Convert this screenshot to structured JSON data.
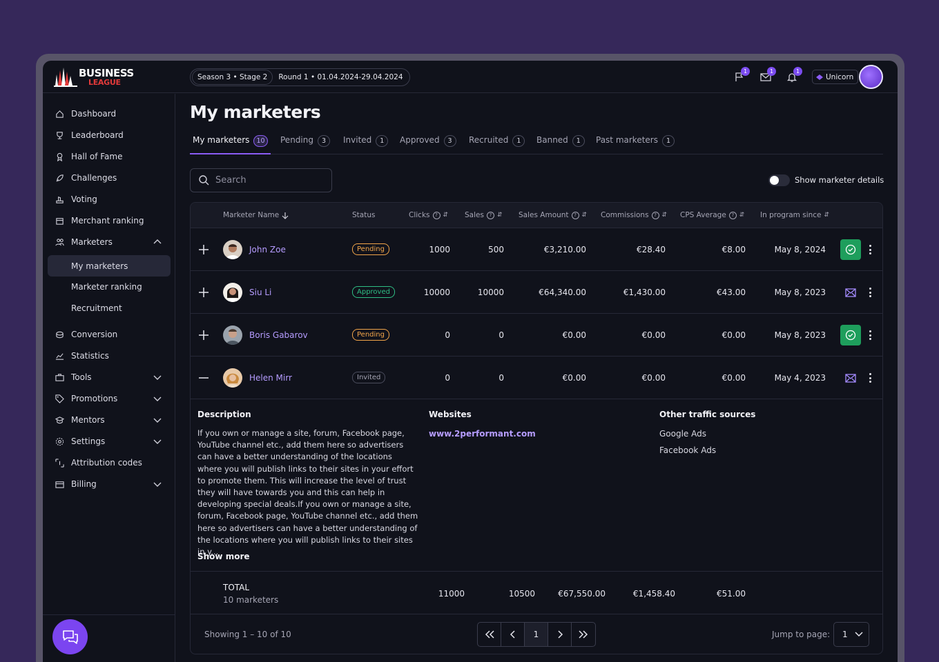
{
  "brand": {
    "line1": "BUSINESS",
    "line2": "LEAGUE"
  },
  "season": {
    "stage": "Season 3 • Stage 2",
    "round": "Round 1 • 01.04.2024-29.04.2024"
  },
  "top_icons": [
    {
      "name": "flag-icon",
      "count": "1"
    },
    {
      "name": "mail-icon",
      "count": "1"
    },
    {
      "name": "bell-icon",
      "count": "1"
    }
  ],
  "account": {
    "label": "Unicorn"
  },
  "sidebar": {
    "items": [
      {
        "label": "Dashboard"
      },
      {
        "label": "Leaderboard"
      },
      {
        "label": "Hall of Fame"
      },
      {
        "label": "Challenges"
      },
      {
        "label": "Voting"
      },
      {
        "label": "Merchant ranking"
      },
      {
        "label": "Marketers"
      },
      {
        "label": "My marketers"
      },
      {
        "label": "Marketer ranking"
      },
      {
        "label": "Recruitment"
      },
      {
        "label": "Conversion"
      },
      {
        "label": "Statistics"
      },
      {
        "label": "Tools"
      },
      {
        "label": "Promotions"
      },
      {
        "label": "Mentors"
      },
      {
        "label": "Settings"
      },
      {
        "label": "Attribution codes"
      },
      {
        "label": "Billing"
      }
    ]
  },
  "page": {
    "title": "My marketers"
  },
  "tabs": [
    {
      "label": "My marketers",
      "count": "10"
    },
    {
      "label": "Pending",
      "count": "3"
    },
    {
      "label": "Invited",
      "count": "1"
    },
    {
      "label": "Approved",
      "count": "3"
    },
    {
      "label": "Recruited",
      "count": "1"
    },
    {
      "label": "Banned",
      "count": "1"
    },
    {
      "label": "Past marketers",
      "count": "1"
    }
  ],
  "search": {
    "placeholder": "Search"
  },
  "toggle": {
    "label": "Show marketer details"
  },
  "table": {
    "columns": [
      "Marketer Name",
      "Status",
      "Clicks",
      "Sales",
      "Sales Amount",
      "Commissions",
      "CPS Average",
      "In program since"
    ],
    "rows": [
      {
        "name": "John Zoe",
        "status": "Pending",
        "clicks": "1000",
        "sales": "500",
        "amount": "€3,210.00",
        "commissions": "€28.40",
        "cps": "€8.00",
        "since": "May 8, 2024"
      },
      {
        "name": "Siu Li",
        "status": "Approved",
        "clicks": "10000",
        "sales": "10000",
        "amount": "€64,340.00",
        "commissions": "€1,430.00",
        "cps": "€43.00",
        "since": "May 8, 2023"
      },
      {
        "name": "Boris Gabarov",
        "status": "Pending",
        "clicks": "0",
        "sales": "0",
        "amount": "€0.00",
        "commissions": "€0.00",
        "cps": "€0.00",
        "since": "May 8, 2023"
      },
      {
        "name": "Helen Mirr",
        "status": "Invited",
        "clicks": "0",
        "sales": "0",
        "amount": "€0.00",
        "commissions": "€0.00",
        "cps": "€0.00",
        "since": "May 4, 2023"
      }
    ],
    "details": {
      "description_title": "Description",
      "description": "If you own or manage a site, forum, Facebook page, YouTube channel etc., add them here so advertisers can have a better understanding of the locations where you will publish links to their sites in your effort to promote them. This will increase the level of trust they will have towards you and this can help in developing special deals.If you own or manage a site, forum, Facebook page, YouTube channel etc., add them here so advertisers can have a better understanding of the locations where you will publish links to their sites in y...",
      "show_more": "Show more",
      "websites_title": "Websites",
      "website": "www.2performant.com",
      "traffic_title": "Other traffic sources",
      "traffic": [
        "Google Ads",
        "Facebook Ads"
      ]
    },
    "total": {
      "label": "TOTAL",
      "sub": "10 marketers",
      "clicks": "11000",
      "sales": "10500",
      "amount": "€67,550.00",
      "commissions": "€1,458.40",
      "cps": "€51.00"
    }
  },
  "pagination": {
    "showing": "Showing 1 – 10 of 10",
    "current": "1",
    "jump_label": "Jump to page:",
    "jump_value": "1"
  },
  "colors": {
    "accent": "#8b5cf6",
    "pending": "#f2a54a",
    "approved": "#2fbf85",
    "ok_button": "#1e9e5c",
    "background": "#36285a"
  }
}
